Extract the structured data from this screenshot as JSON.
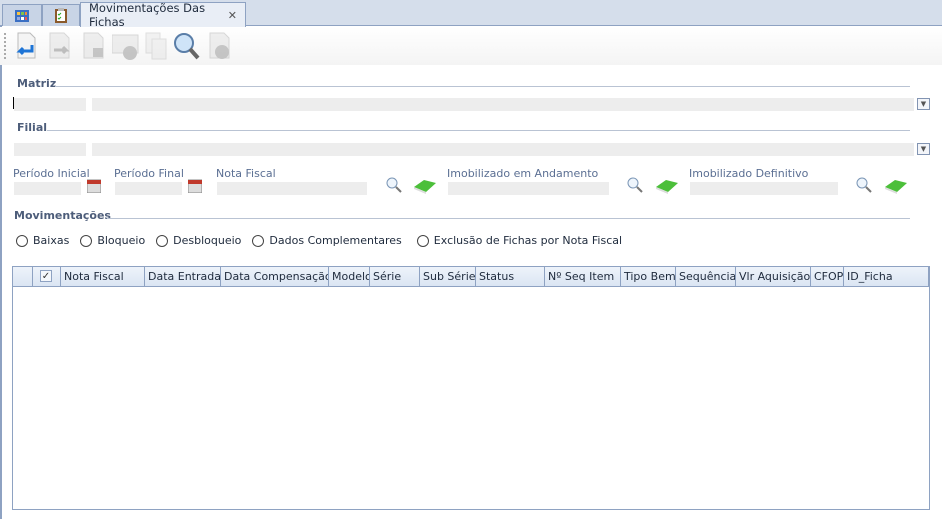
{
  "tabs": [
    {
      "icon": "grid-icon"
    },
    {
      "icon": "clipboard-icon"
    },
    {
      "label": "Movimentações Das Fichas",
      "close": "✕"
    }
  ],
  "toolbar": [
    "new-icon",
    "transfer-icon",
    "lock-doc-icon",
    "approve-icon",
    "copy-icon",
    "search-icon",
    "cancel-icon"
  ],
  "matriz": {
    "title": "Matriz",
    "dropdown": "▼"
  },
  "filial": {
    "title": "Filial",
    "dropdown": "▼"
  },
  "fields": {
    "periodo_inicial": "Período Inicial",
    "periodo_final": "Período Final",
    "nota_fiscal": "Nota Fiscal",
    "imob_andamento": "Imobilizado em Andamento",
    "imob_definitivo": "Imobilizado Definitivo"
  },
  "movimentacoes": {
    "title": "Movimentações",
    "options": [
      "Baixas",
      "Bloqueio",
      "Desbloqueio",
      "Dados Complementares",
      "Exclusão de Fichas por Nota Fiscal"
    ]
  },
  "grid": {
    "columns": [
      "Nota Fiscal",
      "Data Entrada",
      "Data Compensação",
      "Modelo",
      "Série",
      "Sub Série",
      "Status",
      "Nº Seq Item",
      "Tipo Bem",
      "Sequência",
      "Vlr Aquisição",
      "CFOP",
      "ID_Ficha"
    ],
    "select_all": true
  }
}
